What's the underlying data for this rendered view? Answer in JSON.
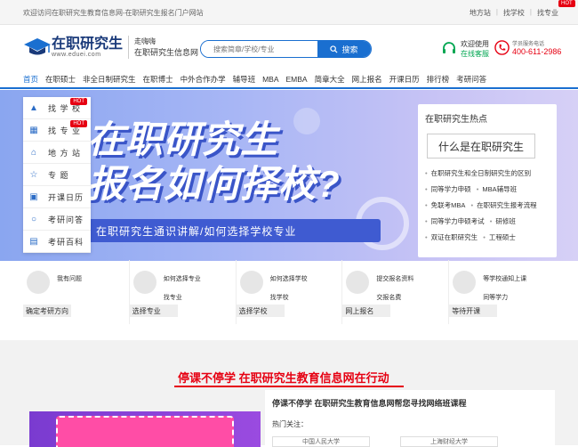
{
  "topbar": {
    "welcome": "欢迎访问在职研究生教育信息网-在职研究生报名门户网站",
    "links": [
      "地方站",
      "找学校",
      "找专业"
    ],
    "hot": "HOT"
  },
  "header": {
    "logo_title": "在职研究生",
    "logo_url": "www.eduei.com",
    "logo_right_1": "走嗨嗨",
    "logo_right_2": "在职研究生信息网",
    "search_placeholder": "搜索简章/学校/专业",
    "search_button": "搜索",
    "service_label": "欢迎使用",
    "service_link": "在线客服",
    "phone_label": "学员服务电话",
    "phone_number": "400-611-2986"
  },
  "nav": [
    "首页",
    "在职硕士",
    "非全日制研究生",
    "在职博士",
    "中外合作办学",
    "辅导班",
    "MBA",
    "EMBA",
    "简章大全",
    "网上报名",
    "开课日历",
    "排行榜",
    "考研问答"
  ],
  "sidebar": [
    {
      "label": "找 学 校",
      "icon": "graduation-cap-icon",
      "hot": "HOT"
    },
    {
      "label": "找 专 业",
      "icon": "grid-icon",
      "hot": "HOT"
    },
    {
      "label": "地 方 站",
      "icon": "home-icon"
    },
    {
      "label": "专    题",
      "icon": "star-icon"
    },
    {
      "label": "开课日历",
      "icon": "calendar-icon"
    },
    {
      "label": "考研问答",
      "icon": "chat-icon"
    },
    {
      "label": "考研百科",
      "icon": "book-icon"
    }
  ],
  "banner": {
    "line1": "在职研究生",
    "line2": "报名如何择校?",
    "subtitle": "在职研究生通识讲解/如何选择学校专业"
  },
  "hot_panel": {
    "title": "在职研究生热点",
    "featured": "什么是在职研究生",
    "rows": [
      [
        "在职研究生和全日制研究生的区别"
      ],
      [
        "同等学力申硕",
        "MBA辅导班"
      ],
      [
        "免联考MBA",
        "在职研究生报考流程"
      ],
      [
        "同等学力申硕考试",
        "研修班"
      ],
      [
        "双证在职研究生",
        "工程硕士"
      ]
    ]
  },
  "features": [
    {
      "t1": "我有问题",
      "t2": "",
      "bar": "确定考研方向"
    },
    {
      "t1": "如何选择专业",
      "t2": "找专业",
      "bar": "选择专业"
    },
    {
      "t1": "如何选择学校",
      "t2": "找学校",
      "bar": "选择学校"
    },
    {
      "t1": "提交报名资料",
      "t2": "交报名费",
      "bar": "网上报名"
    },
    {
      "t1": "等学校通知上课",
      "t2": "同等学力",
      "bar": "等待开课"
    }
  ],
  "section": {
    "slogan": "停课不停学 在职研究生教育信息网在行动",
    "card_title": "停课不停学 在职研究生教育信息网帮您寻找网络班课程",
    "hot_label": "热门关注：",
    "tags": [
      "中国人民大学",
      "上海财经大学"
    ]
  }
}
